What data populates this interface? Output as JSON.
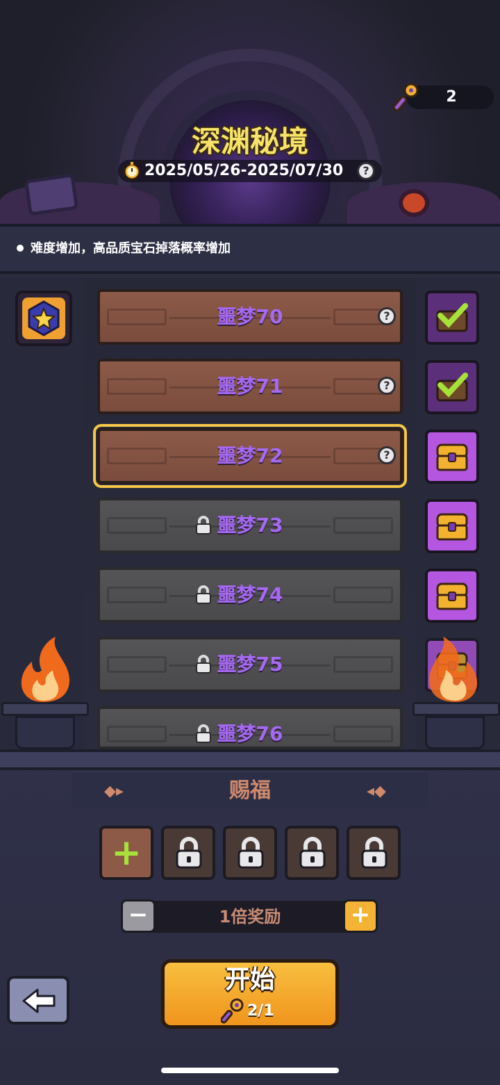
{
  "header": {
    "key_count": "2",
    "title": "深渊秘境",
    "date_range": "2025/05/26-2025/07/30"
  },
  "notice": {
    "text": "难度增加，高品质宝石掉落概率增加"
  },
  "levels": [
    {
      "label": "噩梦70",
      "state": "open",
      "reward": "claimed"
    },
    {
      "label": "噩梦71",
      "state": "open",
      "reward": "claimed"
    },
    {
      "label": "噩梦72",
      "state": "selected",
      "reward": "chest"
    },
    {
      "label": "噩梦73",
      "state": "locked",
      "reward": "chest"
    },
    {
      "label": "噩梦74",
      "state": "locked",
      "reward": "chest"
    },
    {
      "label": "噩梦75",
      "state": "locked",
      "reward": "chest"
    },
    {
      "label": "噩梦76",
      "state": "locked",
      "reward": "none"
    }
  ],
  "blessing": {
    "title": "赐福",
    "slots": [
      "add",
      "locked",
      "locked",
      "locked",
      "locked"
    ]
  },
  "reward_multiplier": "1倍奖励",
  "start": {
    "label": "开始",
    "cost": "2/1"
  },
  "colors": {
    "title_yellow": "#f7e36a",
    "level_text_purple": "#a569f2",
    "selected_outline": "#f6c647",
    "start_orange": "#f0951d"
  }
}
